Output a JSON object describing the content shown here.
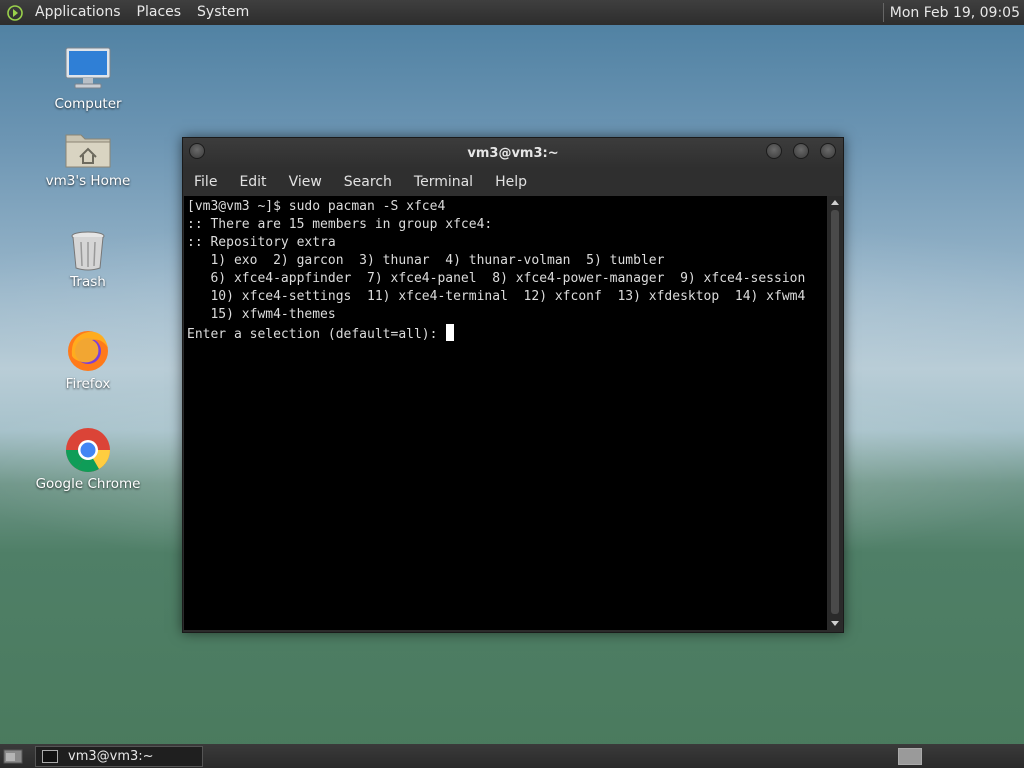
{
  "top_panel": {
    "menu": [
      "Applications",
      "Places",
      "System"
    ],
    "clock": "Mon Feb 19, 09:05"
  },
  "desktop": {
    "icons": [
      {
        "label": "Computer",
        "icon": "computer-icon"
      },
      {
        "label": "vm3's Home",
        "icon": "home-folder-icon"
      },
      {
        "label": "Trash",
        "icon": "trash-icon"
      },
      {
        "label": "Firefox",
        "icon": "firefox-icon"
      },
      {
        "label": "Google Chrome",
        "icon": "chrome-icon"
      }
    ]
  },
  "terminal": {
    "title": "vm3@vm3:~",
    "menu": [
      "File",
      "Edit",
      "View",
      "Search",
      "Terminal",
      "Help"
    ],
    "lines": [
      "[vm3@vm3 ~]$ sudo pacman -S xfce4",
      ":: There are 15 members in group xfce4:",
      ":: Repository extra",
      "   1) exo  2) garcon  3) thunar  4) thunar-volman  5) tumbler",
      "   6) xfce4-appfinder  7) xfce4-panel  8) xfce4-power-manager  9) xfce4-session",
      "   10) xfce4-settings  11) xfce4-terminal  12) xfconf  13) xfdesktop  14) xfwm4",
      "   15) xfwm4-themes",
      "",
      "Enter a selection (default=all): "
    ]
  },
  "bottom_panel": {
    "task": "vm3@vm3:~"
  }
}
